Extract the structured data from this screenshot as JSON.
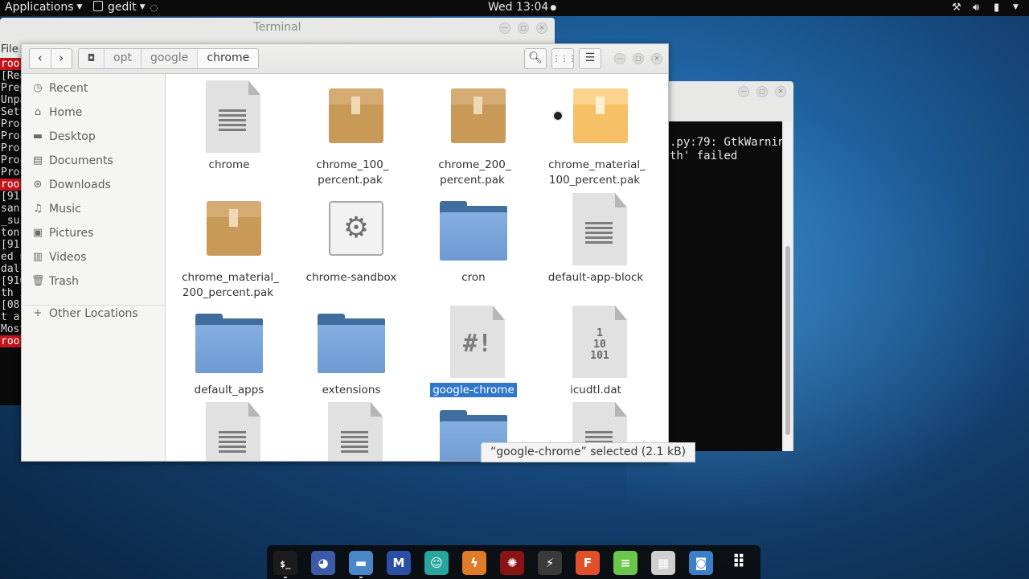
{
  "topbar": {
    "applications": "Applications",
    "app_name": "gedit",
    "clock": "Wed 13:04"
  },
  "terminal_left": {
    "title": "Terminal",
    "menu_file": "File",
    "lines": [
      "roo",
      "[Rea",
      "Prep",
      "Unpa",
      "Sett",
      "Proc",
      "Proc",
      "Proc",
      "Proc",
      "Proc",
      "roo",
      "[911",
      " san",
      "_sui",
      "ton.",
      "[911",
      "ed n",
      "dall",
      "[916",
      "th i",
      "[081",
      "t a",
      "Most",
      "roo"
    ]
  },
  "terminal_right": {
    "lines": [
      ".py:79: GtkWarnin",
      "th' failed"
    ]
  },
  "file_manager": {
    "path": [
      "opt",
      "google",
      "chrome"
    ],
    "sidebar": [
      {
        "label": "Recent",
        "icon": "clock-icon"
      },
      {
        "label": "Home",
        "icon": "home-icon"
      },
      {
        "label": "Desktop",
        "icon": "desktop-icon"
      },
      {
        "label": "Documents",
        "icon": "documents-icon"
      },
      {
        "label": "Downloads",
        "icon": "downloads-icon"
      },
      {
        "label": "Music",
        "icon": "music-icon"
      },
      {
        "label": "Pictures",
        "icon": "pictures-icon"
      },
      {
        "label": "Videos",
        "icon": "videos-icon"
      },
      {
        "label": "Trash",
        "icon": "trash-icon"
      },
      {
        "label": "Other Locations",
        "icon": "plus-icon"
      }
    ],
    "files": [
      {
        "name": "chrome",
        "type": "document"
      },
      {
        "name": "chrome_100_\npercent.pak",
        "type": "package"
      },
      {
        "name": "chrome_200_\npercent.pak",
        "type": "package"
      },
      {
        "name": "chrome_material_\n100_percent.pak",
        "type": "package-light"
      },
      {
        "name": "chrome_material_\n200_percent.pak",
        "type": "package"
      },
      {
        "name": "chrome-sandbox",
        "type": "executable"
      },
      {
        "name": "cron",
        "type": "folder"
      },
      {
        "name": "default-app-block",
        "type": "document"
      },
      {
        "name": "default_apps",
        "type": "folder"
      },
      {
        "name": "extensions",
        "type": "folder"
      },
      {
        "name": "google-chrome",
        "type": "script",
        "selected": true
      },
      {
        "name": "icudtl.dat",
        "type": "binary"
      },
      {
        "name": "",
        "type": "document"
      },
      {
        "name": "",
        "type": "document"
      },
      {
        "name": "",
        "type": "folder"
      },
      {
        "name": "",
        "type": "document"
      }
    ],
    "status": "“google-chrome” selected  (2.1 kB)"
  },
  "dock": [
    {
      "name": "terminal",
      "icon": "terminal-icon",
      "color": "#1c1c1c"
    },
    {
      "name": "wolf",
      "icon": "wolf-icon",
      "color": "#3d5aa8"
    },
    {
      "name": "files",
      "icon": "folder-icon",
      "color": "#4a86c8"
    },
    {
      "name": "maltego",
      "icon": "maltego-icon",
      "color": "#2b4fa6"
    },
    {
      "name": "anime",
      "icon": "character-icon",
      "color": "#28a59e"
    },
    {
      "name": "burp",
      "icon": "lightning-icon",
      "color": "#e07b2a"
    },
    {
      "name": "armitage",
      "icon": "armitage-icon",
      "color": "#8a1414"
    },
    {
      "name": "kali",
      "icon": "dragon-icon",
      "color": "#3a3a3a"
    },
    {
      "name": "faraday",
      "icon": "faraday-icon",
      "color": "#e0502a"
    },
    {
      "name": "notes",
      "icon": "notes-icon",
      "color": "#6cc64a"
    },
    {
      "name": "cherrytree",
      "icon": "cherrytree-icon",
      "color": "#cfcfcf"
    },
    {
      "name": "screenshot",
      "icon": "camera-icon",
      "color": "#3b7fc9"
    },
    {
      "name": "app-grid",
      "icon": "grid-icon",
      "color": "transparent"
    }
  ]
}
